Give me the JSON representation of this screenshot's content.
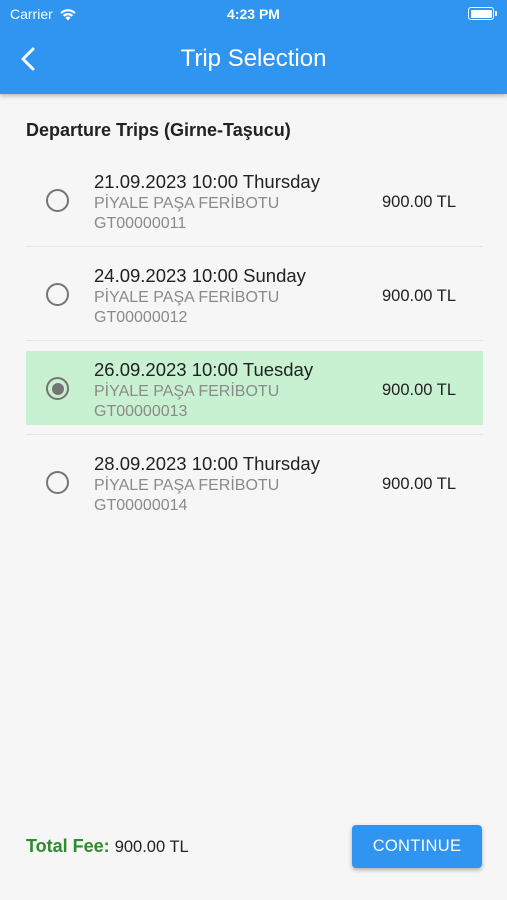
{
  "status_bar": {
    "carrier": "Carrier",
    "time": "4:23 PM",
    "battery_level": 1.0
  },
  "header": {
    "title": "Trip Selection",
    "back_icon": "chevron-left-icon"
  },
  "section": {
    "title": "Departure Trips (Girne-Taşucu)"
  },
  "trips": [
    {
      "date": "21.09.2023 10:00 Thursday",
      "vessel": "PİYALE PAŞA FERİBOTU",
      "code": "GT00000011",
      "price": "900.00 TL",
      "selected": false
    },
    {
      "date": "24.09.2023 10:00 Sunday",
      "vessel": "PİYALE PAŞA FERİBOTU",
      "code": "GT00000012",
      "price": "900.00 TL",
      "selected": false
    },
    {
      "date": "26.09.2023 10:00 Tuesday",
      "vessel": "PİYALE PAŞA FERİBOTU",
      "code": "GT00000013",
      "price": "900.00 TL",
      "selected": true
    },
    {
      "date": "28.09.2023 10:00 Thursday",
      "vessel": "PİYALE PAŞA FERİBOTU",
      "code": "GT00000014",
      "price": "900.00 TL",
      "selected": false
    }
  ],
  "footer": {
    "total_label": "Total Fee:",
    "total_value": "900.00 TL",
    "continue_label": "CONTINUE"
  },
  "colors": {
    "primary": "#2f95f1",
    "selected_row": "#c8f1d2",
    "total_label": "#2e8b2e"
  }
}
